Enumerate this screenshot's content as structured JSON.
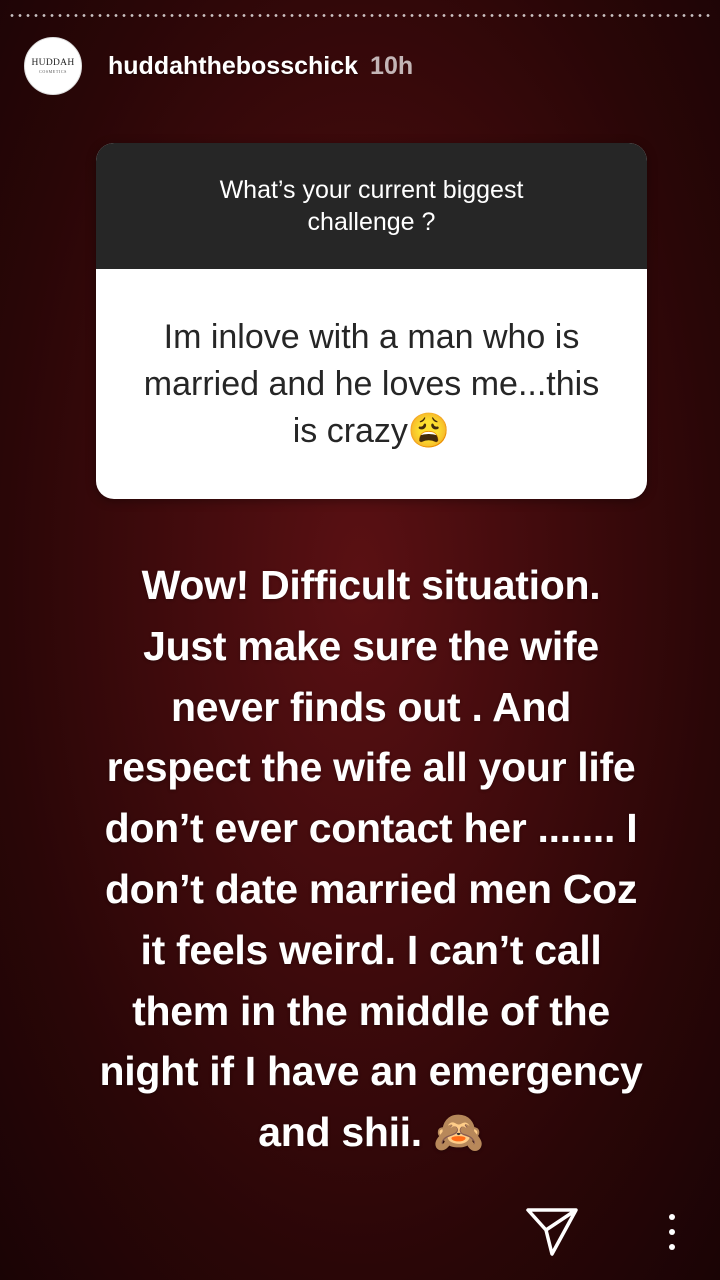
{
  "header": {
    "avatar_logo": "HUDDAH",
    "avatar_logo_sub": "COSMETICS",
    "username": "huddahthebosschick",
    "time_ago": "10h"
  },
  "question_sticker": {
    "question": "What’s your current biggest challenge ?",
    "answer": "Im inlove with a man who is married and he loves me...this is crazy😩"
  },
  "reply_text": "Wow! Difficult situation. Just make sure the wife never finds out . And respect the wife all your life don’t ever contact her ....... I don’t date married men Coz it feels weird. I can’t call them in the middle of the night if I have an emergency and shii. 🙈",
  "controls": {
    "send_icon": "paper-plane-icon",
    "more_icon": "vertical-ellipsis-icon"
  },
  "colors": {
    "background": "#420b0d",
    "question_header": "#262626",
    "text": "#ffffff"
  }
}
